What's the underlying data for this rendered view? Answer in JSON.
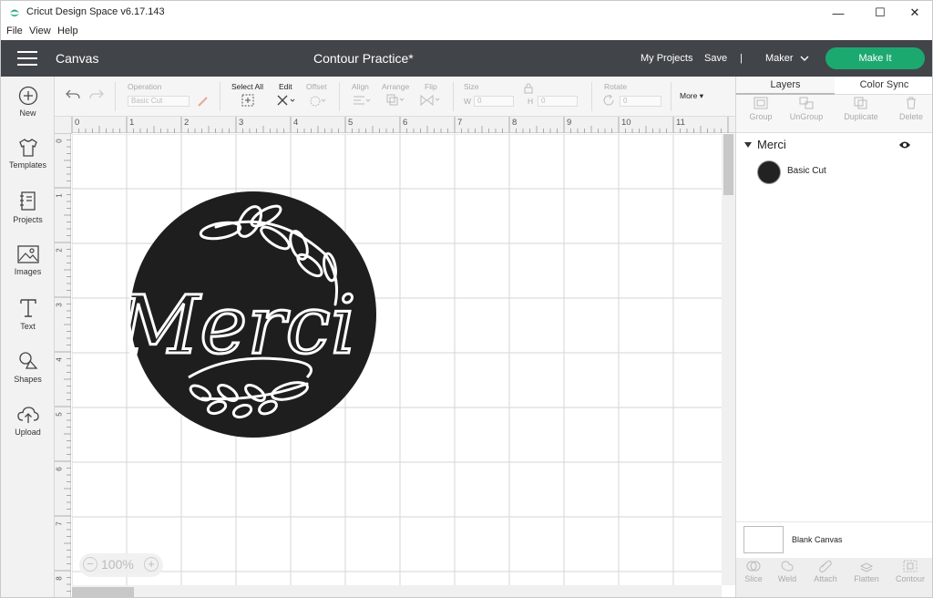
{
  "window": {
    "title": "Cricut Design Space  v6.17.143",
    "minimize_icon": "—",
    "maximize_icon": "☐",
    "close_icon": "✕"
  },
  "menu": [
    "File",
    "View",
    "Help"
  ],
  "header": {
    "section": "Canvas",
    "project_title": "Contour Practice*",
    "my_projects": "My Projects",
    "save": "Save",
    "divider": "|",
    "machine": "Maker",
    "make_it": "Make It",
    "accent_color": "#1ca970",
    "bar_color": "#414549"
  },
  "left_tools": [
    {
      "label": "New",
      "icon": "plus-circle-icon"
    },
    {
      "label": "Templates",
      "icon": "shirt-icon"
    },
    {
      "label": "Projects",
      "icon": "notebook-icon"
    },
    {
      "label": "Images",
      "icon": "image-icon"
    },
    {
      "label": "Text",
      "icon": "text-t-icon"
    },
    {
      "label": "Shapes",
      "icon": "shapes-icon"
    },
    {
      "label": "Upload",
      "icon": "cloud-upload-icon"
    }
  ],
  "toolbar": {
    "operation_label": "Operation",
    "operation_value": "Basic Cut",
    "select_all": "Select All",
    "edit": "Edit",
    "offset": "Offset",
    "align": "Align",
    "arrange": "Arrange",
    "flip": "Flip",
    "size": "Size",
    "w_label": "W",
    "h_label": "H",
    "w_value": "0",
    "h_value": "0",
    "rotate": "Rotate",
    "rotate_value": "0",
    "more": "More ▾"
  },
  "ruler": {
    "h_ticks": [
      "0",
      "1",
      "2",
      "3",
      "4",
      "5",
      "6",
      "7",
      "8",
      "9",
      "10",
      "11"
    ],
    "v_ticks": [
      "0",
      "1",
      "2",
      "3",
      "4",
      "5",
      "6",
      "7",
      "8"
    ]
  },
  "canvas": {
    "design_text": "Merci",
    "zoom": "100%",
    "zoom_minus": "−",
    "zoom_plus": "+"
  },
  "right_panel": {
    "tabs": [
      "Layers",
      "Color Sync"
    ],
    "actions": [
      "Group",
      "UnGroup",
      "Duplicate",
      "Delete"
    ],
    "layer_group": "Merci",
    "layer_item": "Basic Cut",
    "blank_canvas": "Blank Canvas",
    "bottom_actions": [
      "Slice",
      "Weld",
      "Attach",
      "Flatten",
      "Contour"
    ]
  }
}
